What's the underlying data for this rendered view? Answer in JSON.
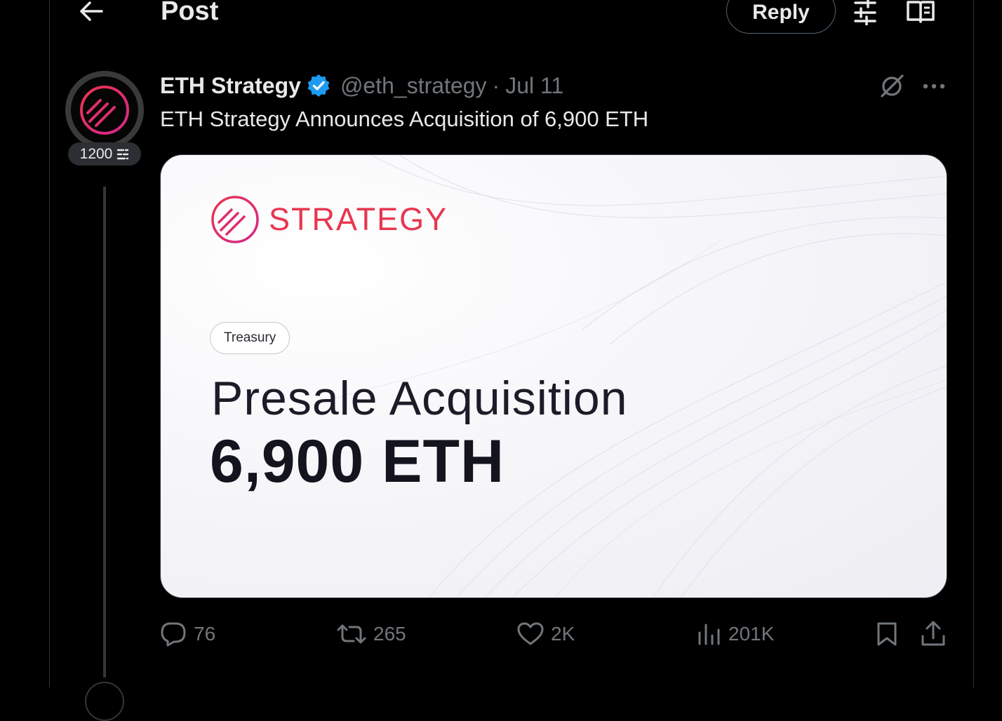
{
  "header": {
    "title": "Post",
    "reply_label": "Reply",
    "icons": [
      "back-arrow-icon",
      "sliders-icon",
      "reader-icon"
    ]
  },
  "author": {
    "name": "ETH Strategy",
    "handle": "@eth_strategy",
    "separator": "·",
    "date": "Jul 11",
    "verified": true,
    "level_badge": "1200"
  },
  "post": {
    "text": "ETH Strategy Announces Acquisition of 6,900 ETH"
  },
  "media": {
    "brand": "STRATEGY",
    "tag": "Treasury",
    "headline": "Presale Acquisition",
    "amount": "6,900 ETH"
  },
  "actions": {
    "replies": "76",
    "reposts": "265",
    "likes": "2K",
    "views": "201K"
  },
  "colors": {
    "background": "#000000",
    "text": "#e7e9ea",
    "muted": "#71767b",
    "border": "#2f3336",
    "verified": "#1d9bf0",
    "brand_red": "#e8364f",
    "brand_pink": "#d6268a"
  }
}
